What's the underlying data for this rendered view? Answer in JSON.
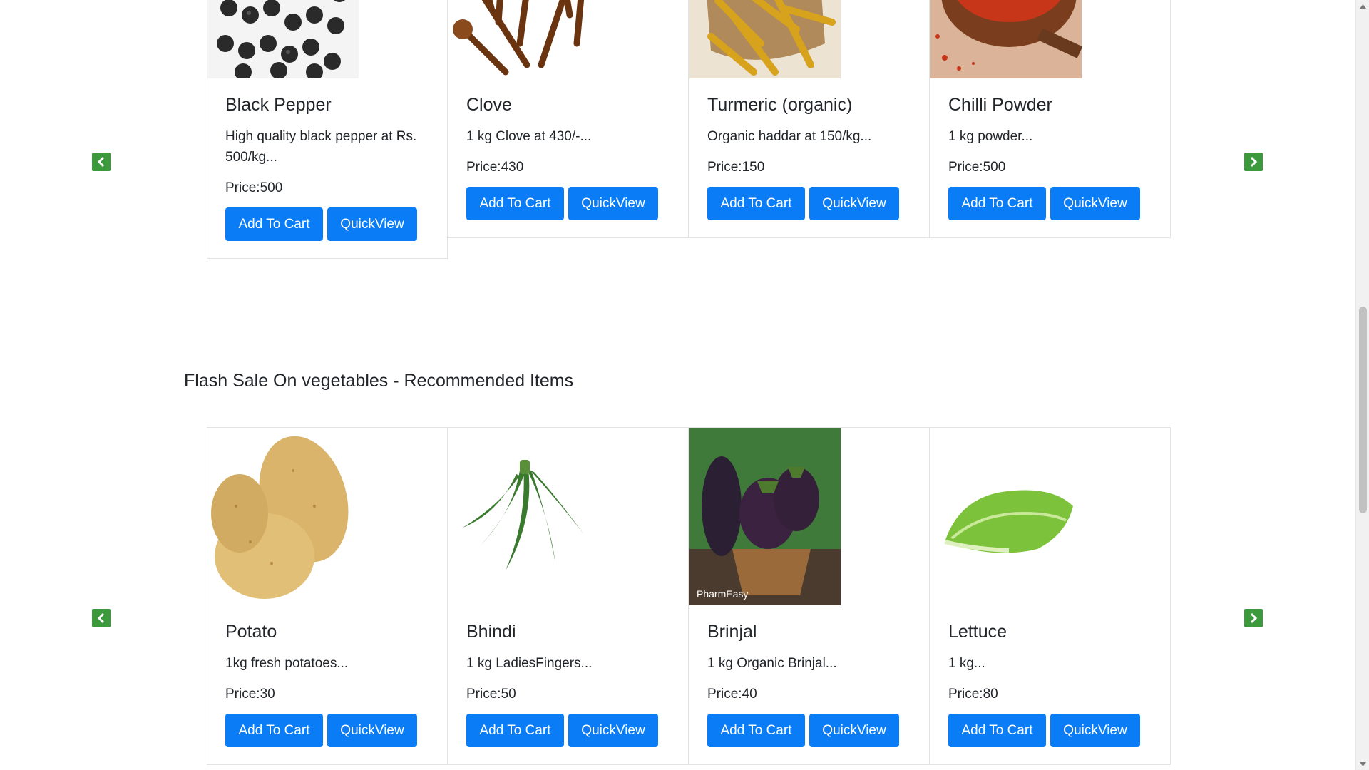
{
  "carousels": [
    {
      "heading": "",
      "items": [
        {
          "name": "Black Pepper",
          "desc": "High quality black pepper at Rs. 500/kg...",
          "price": "Price:500",
          "add": "Add To Cart",
          "quick": "QuickView",
          "image": "black-pepper-photo"
        },
        {
          "name": "Clove",
          "desc": "1 kg Clove at 430/-...",
          "price": "Price:430",
          "add": "Add To Cart",
          "quick": "QuickView",
          "image": "clove-photo"
        },
        {
          "name": "Turmeric (organic)",
          "desc": "Organic haddar at 150/kg...",
          "price": "Price:150",
          "add": "Add To Cart",
          "quick": "QuickView",
          "image": "turmeric-photo"
        },
        {
          "name": "Chilli Powder",
          "desc": "1 kg powder...",
          "price": "Price:500",
          "add": "Add To Cart",
          "quick": "QuickView",
          "image": "chilli-powder-photo"
        }
      ]
    },
    {
      "heading": "Flash Sale On vegetables - Recommended Items",
      "items": [
        {
          "name": "Potato",
          "desc": "1kg fresh potatoes...",
          "price": "Price:30",
          "add": "Add To Cart",
          "quick": "QuickView",
          "image": "potato-photo"
        },
        {
          "name": "Bhindi",
          "desc": "1 kg LadiesFingers...",
          "price": "Price:50",
          "add": "Add To Cart",
          "quick": "QuickView",
          "image": "bhindi-photo"
        },
        {
          "name": "Brinjal",
          "desc": "1 kg Organic Brinjal...",
          "price": "Price:40",
          "add": "Add To Cart",
          "quick": "QuickView",
          "image": "brinjal-photo",
          "watermark": "PharmEasy"
        },
        {
          "name": "Lettuce",
          "desc": "1 kg...",
          "price": "Price:80",
          "add": "Add To Cart",
          "quick": "QuickView",
          "image": "lettuce-photo"
        }
      ]
    }
  ],
  "icons": {
    "prev": "chevron-left-icon",
    "next": "chevron-right-icon"
  },
  "colors": {
    "button": "#0a7cf6",
    "arrow": "#3c9a3c",
    "border": "#e3e3e3"
  }
}
